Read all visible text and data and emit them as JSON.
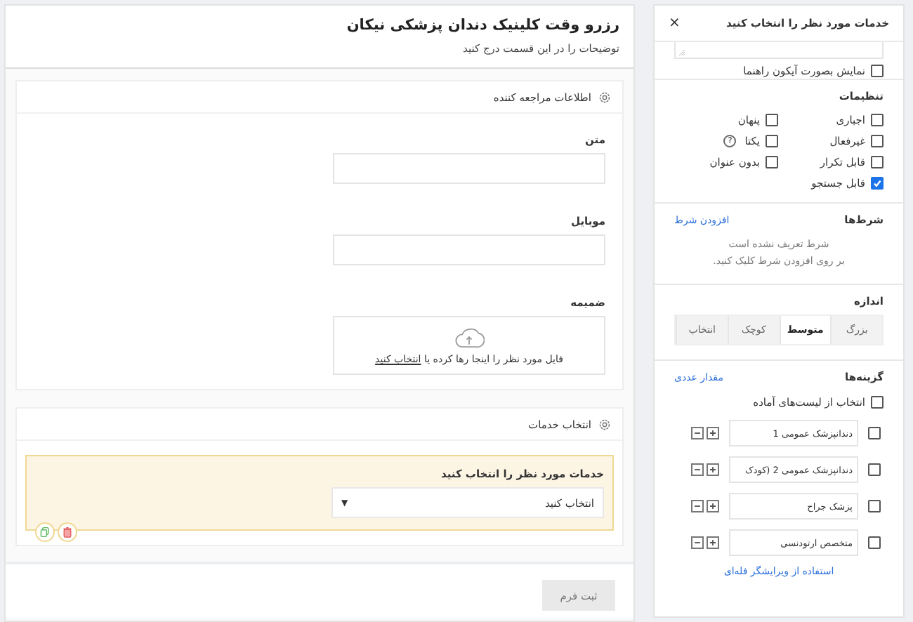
{
  "form": {
    "title": "رزرو وقت کلینیک دندان پزشکی نیکان",
    "description": "توضیحات را در این قسمت درج کنید",
    "sections": [
      {
        "title": "اطلاعات مراجعه کننده",
        "fields": [
          {
            "kind": "text",
            "label": "متن"
          },
          {
            "kind": "text",
            "label": "موبایل"
          },
          {
            "kind": "file",
            "label": "ضمیمه",
            "drop_text": "فایل مورد نظر را اینجا رها کرده یا",
            "link": "انتخاب کنید"
          }
        ]
      },
      {
        "title": "انتخاب خدمات",
        "fields": [
          {
            "kind": "select",
            "label": "خدمات مورد نظر را انتخاب کنید",
            "value": "انتخاب کنید",
            "arrow": "▼",
            "selected": true
          }
        ]
      }
    ],
    "submit": "ثبت فرم"
  },
  "panel": {
    "title": "خدمات مورد نظر را انتخاب کنید",
    "close": "×",
    "show_as_icon": {
      "label": "نمایش بصورت آیکون راهنما",
      "checked": false
    },
    "settings": {
      "title": "تنظیمات",
      "items": [
        {
          "label": "اجباری",
          "checked": false
        },
        {
          "label": "پنهان",
          "checked": false
        },
        {
          "label": "غیرفعال",
          "checked": false
        },
        {
          "label": "یکتا",
          "checked": false,
          "hint": "?"
        },
        {
          "label": "قابل تکرار",
          "checked": false
        },
        {
          "label": "بدون عنوان",
          "checked": false
        },
        {
          "label": "قابل جستجو",
          "checked": true
        }
      ]
    },
    "conditions": {
      "title": "شرط‌ها",
      "link": "افزودن شرط",
      "empty_lines": [
        "شرط تعریف نشده است",
        "بر روی افزودن شرط کلیک کنید."
      ]
    },
    "size": {
      "title": "اندازه",
      "tabs": [
        {
          "label": "بزرگ",
          "selected": false
        },
        {
          "label": "متوسط",
          "selected": true
        },
        {
          "label": "کوچک",
          "selected": false
        },
        {
          "label": "انتخاب",
          "selected": false
        }
      ]
    },
    "options": {
      "title": "گزینه‌ها",
      "link": "مقدار عددی",
      "preset": {
        "label": "انتخاب از لیست‌های آماده",
        "checked": false
      },
      "items": [
        {
          "value": "دندانپزشک عمومی 1",
          "checked": false
        },
        {
          "value": "دندانپزشک عمومی 2 (کودک",
          "checked": false
        },
        {
          "value": "پزشک جراح",
          "checked": false
        },
        {
          "value": "متخصص ارتودنسی",
          "checked": false
        }
      ],
      "bulk_link": "استفاده از ویرایشگر فله‌ای"
    }
  }
}
